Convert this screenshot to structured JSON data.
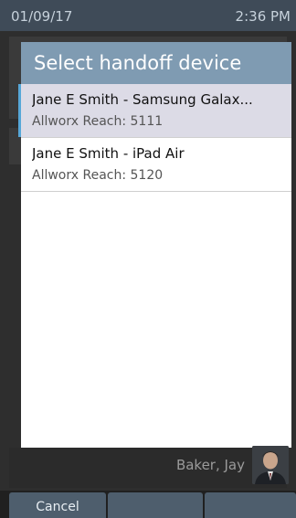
{
  "status_bar": {
    "date": "01/09/17",
    "time": "2:36 PM"
  },
  "dialog": {
    "title": "Select handoff device",
    "devices": [
      {
        "name": "Jane E Smith - Samsung Galax...",
        "subtitle": "Allworx Reach: 5111",
        "selected": true
      },
      {
        "name": "Jane E Smith - iPad Air",
        "subtitle": "Allworx Reach: 5120",
        "selected": false
      }
    ]
  },
  "background": {
    "contact_name": "Baker, Jay"
  },
  "softkeys": [
    {
      "label": "Cancel"
    },
    {
      "label": ""
    },
    {
      "label": ""
    }
  ],
  "colors": {
    "status_bar": "#3f4b58",
    "dialog_title_bar": "#7f9bb2",
    "selected_item": "#dcdbe6",
    "selected_accent": "#56a7d8",
    "softkey": "#4e5e6d"
  }
}
